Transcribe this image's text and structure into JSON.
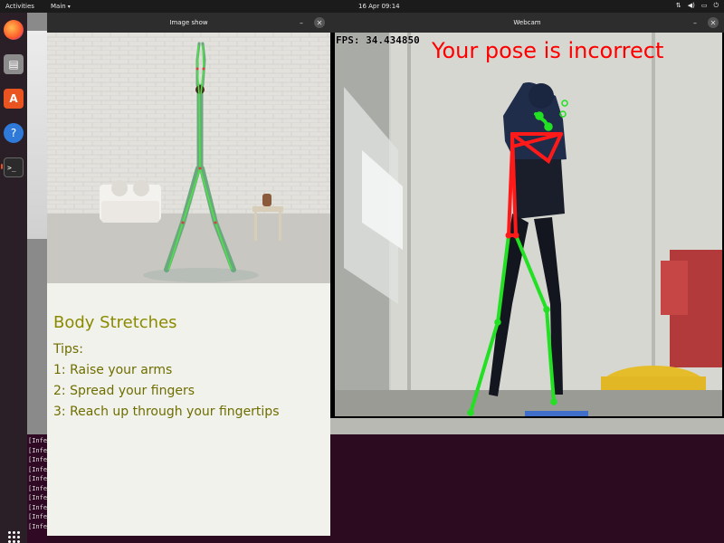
{
  "topbar": {
    "activities": "Activities",
    "app_menu": "Main",
    "clock": "16 Apr  09:14",
    "tray": [
      "network-icon",
      "volume-icon",
      "battery-icon",
      "power-icon"
    ]
  },
  "dock": {
    "items": [
      "firefox-icon",
      "files-icon",
      "software-icon",
      "help-icon",
      "terminal-icon",
      "show-apps-icon"
    ]
  },
  "terminal": {
    "lines": [
      "[Infe",
      "[Infe",
      "[Infe",
      "[Infe",
      "[Infe",
      "[Infe",
      "[Infe",
      "[Infe",
      "[Infe",
      "[Infe"
    ]
  },
  "image_window": {
    "title": "Image show",
    "heading": "Body Stretches",
    "tips_label": "Tips:",
    "tips": [
      "1: Raise your arms",
      "2: Spread your fingers",
      "3: Reach up through your fingertips"
    ]
  },
  "webcam_window": {
    "title": "Webcam",
    "fps": "FPS: 34.434850",
    "pose_message": "Your pose is incorrect"
  },
  "colors": {
    "pose_incorrect": "#ff0000",
    "pose_correct": "#00ff00",
    "tips_text": "#6e6e00",
    "desktop_bg": "#2c0a20"
  }
}
